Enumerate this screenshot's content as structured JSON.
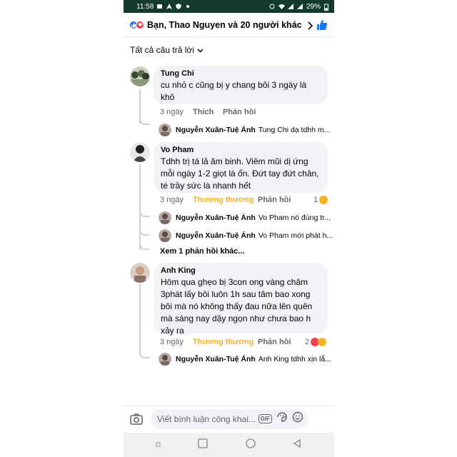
{
  "status_bar": {
    "time": "11:58",
    "battery": "29%"
  },
  "header": {
    "title": "Bạn, Thao Nguyen và 20 người khác"
  },
  "filter": {
    "label": "Tất cả câu trả lời"
  },
  "comments": [
    {
      "author": "Tung Chi",
      "text": "cu nhỏ c cũng bị y chang bôi 3 ngày là khô",
      "time": "3 ngày",
      "reaction_label": "Thích",
      "reply_label": "Phản hồi",
      "reaction_count": "",
      "replies": [
        {
          "author": "Nguyễn Xuân-Tuệ Ánh",
          "text": "Tung Chi dạ tdhh m..."
        }
      ],
      "more_replies": ""
    },
    {
      "author": "Vo Pham",
      "text": "Tdhh trị tá lả ăm binh. Viêm mũi dị ứng mỗi ngày 1-2 giọt là ổn. Đứt tay đứt chân, té trầy sức là nhanh hết",
      "time": "3 ngày",
      "reaction_label": "Thương thương",
      "reply_label": "Phản hồi",
      "reaction_count": "1",
      "replies": [
        {
          "author": "Nguyễn Xuân-Tuệ Ánh",
          "text": "Vo Pham nó đúng tr..."
        },
        {
          "author": "Nguyễn Xuân-Tuệ Ánh",
          "text": "Vo Pham mới phát h..."
        }
      ],
      "more_replies": "Xem 1 phản hồi khác..."
    },
    {
      "author": "Anh King",
      "text": "Hôm qua ghẹo bị 3con ong vàng châm 3phát lấy bôi luôn 1h sau  tâm bao xong bôi mà nó không thấy đau nữa lên quên mà sáng nay dậy  ngọn như chưa bao h xảy ra",
      "time": "3 ngày",
      "reaction_label": "Thương thương",
      "reply_label": "Phản hồi",
      "reaction_count": "2",
      "replies": [
        {
          "author": "Nguyễn Xuân-Tuệ Ánh",
          "text": "Anh King tdhh xịn lắ..."
        }
      ],
      "more_replies": ""
    }
  ],
  "composer": {
    "placeholder": "Viết bình luận công khai...",
    "gif_label": "GIF"
  },
  "colors": {
    "status_bar_bg": "#123a2e",
    "facebook_blue": "#1877f2",
    "love_orange": "#f7b125",
    "bubble_bg": "#f0f2f5"
  }
}
